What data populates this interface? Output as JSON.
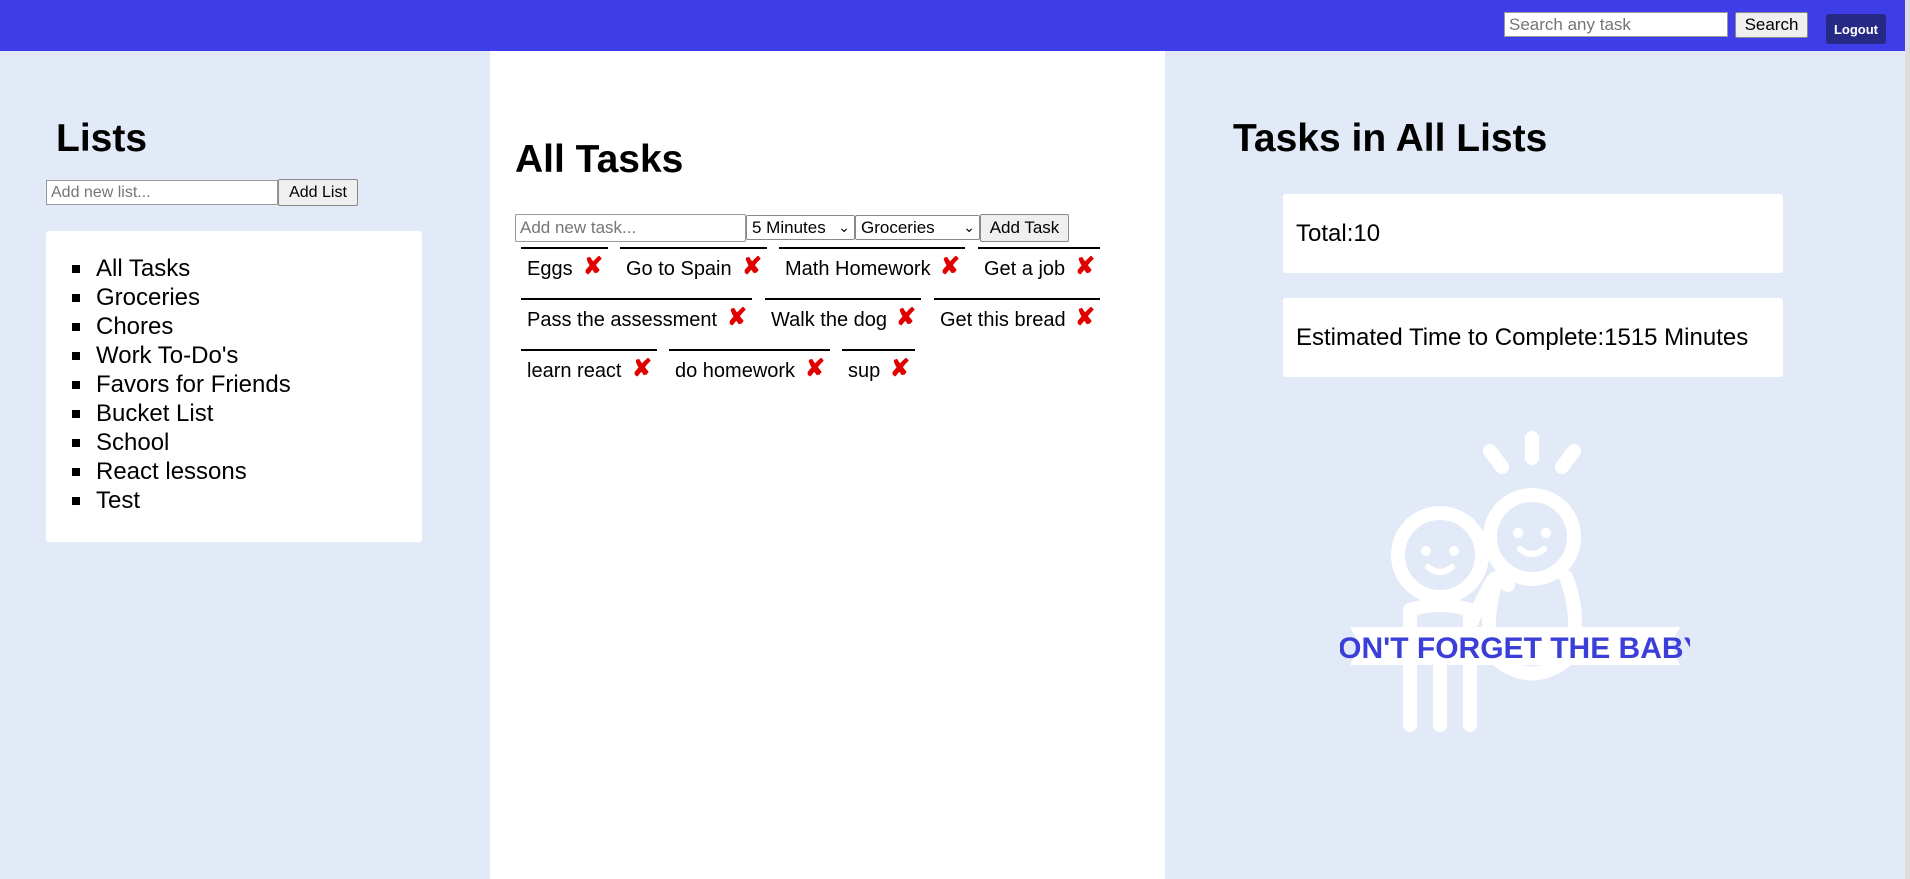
{
  "header": {
    "search_placeholder": "Search any task",
    "search_label": "Search",
    "logout_label": "Logout",
    "bar_color": "#3f3de8"
  },
  "lists": {
    "title": "Lists",
    "input_placeholder": "Add new list...",
    "add_label": "Add List",
    "items": [
      {
        "label": "All Tasks"
      },
      {
        "label": "Groceries"
      },
      {
        "label": "Chores"
      },
      {
        "label": "Work To-Do's"
      },
      {
        "label": "Favors for Friends"
      },
      {
        "label": "Bucket List"
      },
      {
        "label": "School"
      },
      {
        "label": "React lessons"
      },
      {
        "label": "Test"
      }
    ]
  },
  "tasks": {
    "title": "All Tasks",
    "input_placeholder": "Add new task...",
    "time_select": "5 Minutes",
    "list_select": "Groceries",
    "add_label": "Add Task",
    "delete_icon": "✘",
    "items": [
      {
        "label": "Eggs"
      },
      {
        "label": "Go to Spain"
      },
      {
        "label": "Math Homework"
      },
      {
        "label": "Get a job"
      },
      {
        "label": "Pass the assessment"
      },
      {
        "label": "Walk the dog"
      },
      {
        "label": "Get this bread"
      },
      {
        "label": "learn react"
      },
      {
        "label": "do homework"
      },
      {
        "label": "sup"
      }
    ]
  },
  "summary": {
    "title": "Tasks in All Lists",
    "total_label": "Total:10",
    "time_label": "Estimated Time to Complete:1515 Minutes",
    "banner_text": "DON'T FORGET THE BABY!",
    "banner_color": "#3b3fd8"
  }
}
